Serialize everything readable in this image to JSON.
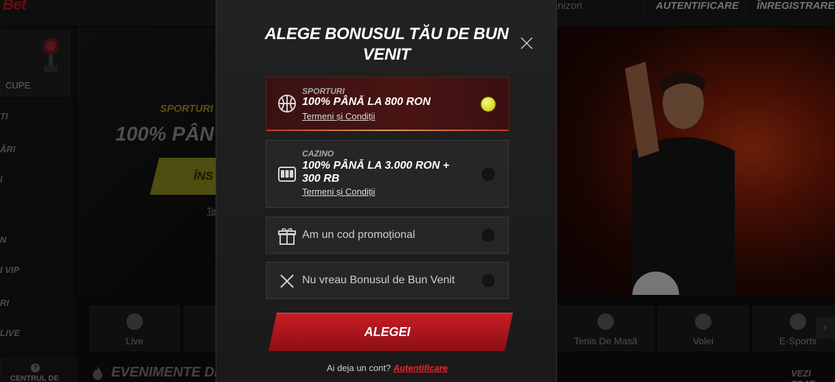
{
  "background": {
    "logo": "Bet",
    "top_link_partial": "nizori",
    "login_button": "AUTENTIFICARE",
    "register_button": "ÎNREGISTRARE",
    "sidebar": {
      "cupe": "CUPE",
      "items": [
        "TI",
        "ĂRI",
        "I",
        "N",
        "I VIP",
        "RI",
        "LIVE"
      ],
      "help": "CENTRUL DE"
    },
    "hero_left": {
      "sport": "SPORTURI",
      "amount": "100% PÂN",
      "button": "ÎNS",
      "terms": "Te"
    },
    "sport_tiles": [
      "Live",
      "Tenis De Masă",
      "Volei",
      "E-Sports"
    ],
    "events_title": "EVENIMENTE DE",
    "see_all": "VEZI TOAT"
  },
  "modal": {
    "title": "ALEGE BONUSUL TĂU DE BUN VENIT",
    "options": [
      {
        "category": "SPORTURI",
        "amount": "100% PÂNĂ LA 800 RON",
        "terms": "Termeni și Condiții",
        "icon": "basketball-icon",
        "selected": true
      },
      {
        "category": "CAZINO",
        "amount": "100% PÂNĂ LA 3.000 RON + 300 RB",
        "terms": "Termeni și Condiții",
        "icon": "slot-machine-icon",
        "selected": false
      },
      {
        "label": "Am un cod promoțional",
        "icon": "gift-icon",
        "selected": false
      },
      {
        "label": "Nu vreau Bonusul de Bun Venit",
        "icon": "x-icon",
        "selected": false
      }
    ],
    "cta": "ALEGEI",
    "footer_text": "Ai deja un cont?",
    "footer_link": "Autentificare"
  },
  "colors": {
    "accent_red": "#c91d26",
    "radio_selected": "#e6f14a",
    "link_red": "#e8262e"
  }
}
